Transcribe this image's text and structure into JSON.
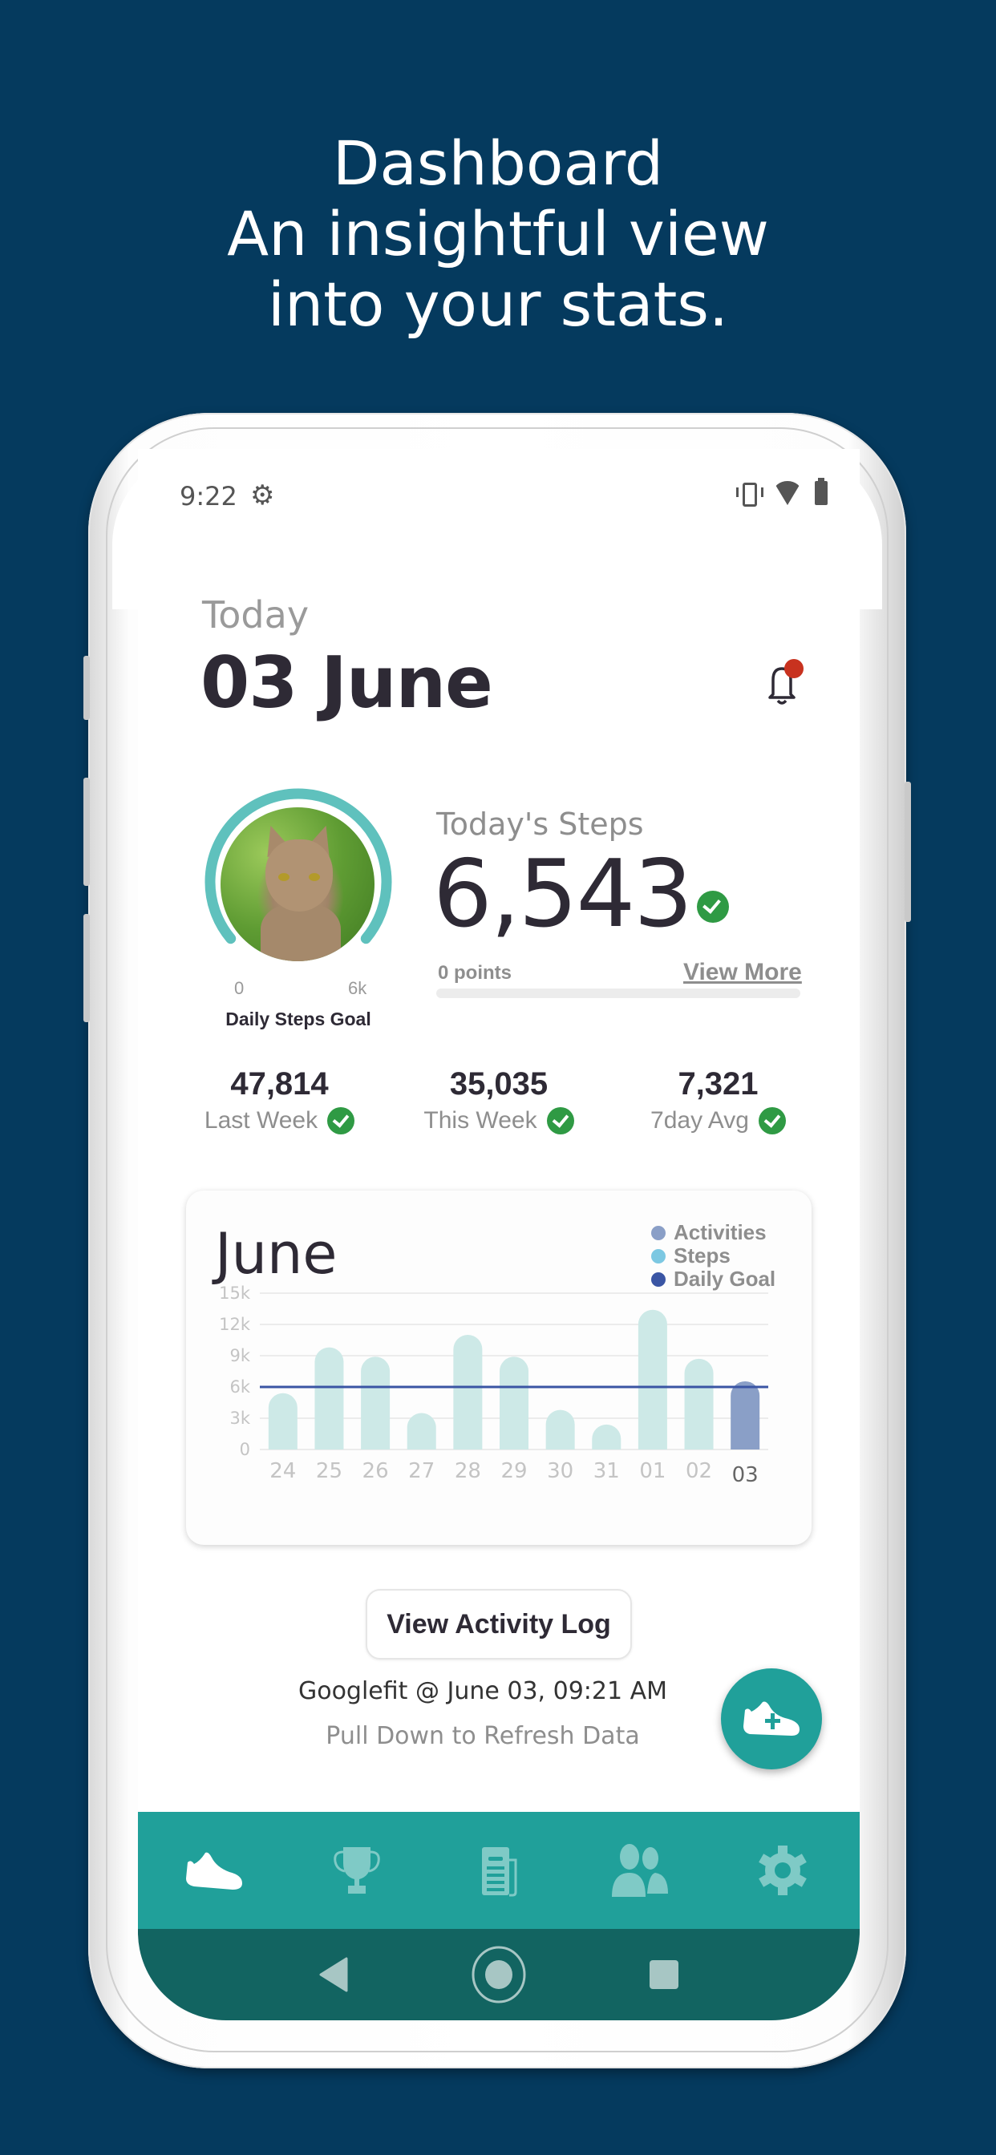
{
  "headline": {
    "line1": "Dashboard",
    "line2": "An insightful view",
    "line3": "into your stats."
  },
  "status_bar": {
    "time": "9:22",
    "icons": [
      "gear-icon",
      "vibrate-icon",
      "wifi-icon",
      "battery-icon"
    ]
  },
  "header": {
    "today_label": "Today",
    "date": "03 June",
    "notification_icon": "bell-icon",
    "has_unread_notification": true
  },
  "goal_ring": {
    "min_label": "0",
    "max_label": "6k",
    "caption": "Daily Steps Goal",
    "progress_fraction": 1.0
  },
  "today_steps": {
    "label": "Today's Steps",
    "value": "6,543",
    "goal_met": true,
    "points_label": "0 points",
    "points_progress_fraction": 0,
    "view_more_label": "View More"
  },
  "stats": [
    {
      "value": "47,814",
      "label": "Last Week",
      "goal_met": true
    },
    {
      "value": "35,035",
      "label": "This Week",
      "goal_met": true
    },
    {
      "value": "7,321",
      "label": "7day Avg",
      "goal_met": true
    }
  ],
  "chart_data": {
    "type": "bar",
    "title": "June",
    "categories": [
      "24",
      "25",
      "26",
      "27",
      "28",
      "29",
      "30",
      "31",
      "01",
      "02",
      "03"
    ],
    "series": [
      {
        "name": "Steps",
        "values": [
          5400,
          9800,
          8900,
          3500,
          11000,
          8900,
          3800,
          2400,
          13400,
          8700,
          null
        ]
      },
      {
        "name": "Activities",
        "values": [
          null,
          null,
          null,
          null,
          null,
          null,
          null,
          null,
          null,
          null,
          6543
        ]
      }
    ],
    "goal_line": {
      "name": "Daily Goal",
      "value": 6000
    },
    "highlighted_category": "03",
    "yticks": [
      "0",
      "3k",
      "6k",
      "9k",
      "12k",
      "15k"
    ],
    "ytick_values": [
      0,
      3000,
      6000,
      9000,
      12000,
      15000
    ],
    "ylim": [
      0,
      15000
    ],
    "xlabel": "",
    "ylabel": "",
    "grid": true,
    "legend": [
      {
        "name": "Activities",
        "color": "#8a9fc7"
      },
      {
        "name": "Steps",
        "color": "#7cc8e2"
      },
      {
        "name": "Daily Goal",
        "color": "#3a55a4"
      }
    ],
    "legend_position": "top-right",
    "colors": {
      "steps_bar": "#cde9e7",
      "activity_bar": "#8a9fc7",
      "goal_line": "#3a55a4",
      "grid": "#ececec"
    }
  },
  "actions": {
    "activity_log_label": "View Activity Log",
    "sync_text": "Googlefit @ June 03, 09:21 AM",
    "refresh_hint": "Pull Down to Refresh Data",
    "fab_icon": "add-activity-shoe-icon"
  },
  "bottom_nav": {
    "items": [
      {
        "name": "activity",
        "icon": "shoe-icon",
        "active": true
      },
      {
        "name": "challenges",
        "icon": "trophy-icon",
        "active": false
      },
      {
        "name": "news",
        "icon": "newspaper-icon",
        "active": false
      },
      {
        "name": "team",
        "icon": "people-icon",
        "active": false
      },
      {
        "name": "settings",
        "icon": "gear-icon",
        "active": false
      }
    ]
  },
  "system_nav": {
    "items": [
      "back-icon",
      "home-icon",
      "recents-icon"
    ]
  },
  "colors": {
    "background": "#053a5e",
    "accent": "#20a09a",
    "accent_dark": "#126461",
    "success": "#2f9a44",
    "alert": "#c8321f",
    "text_dark": "#2e2a35",
    "text_muted": "#8e8e8e"
  }
}
